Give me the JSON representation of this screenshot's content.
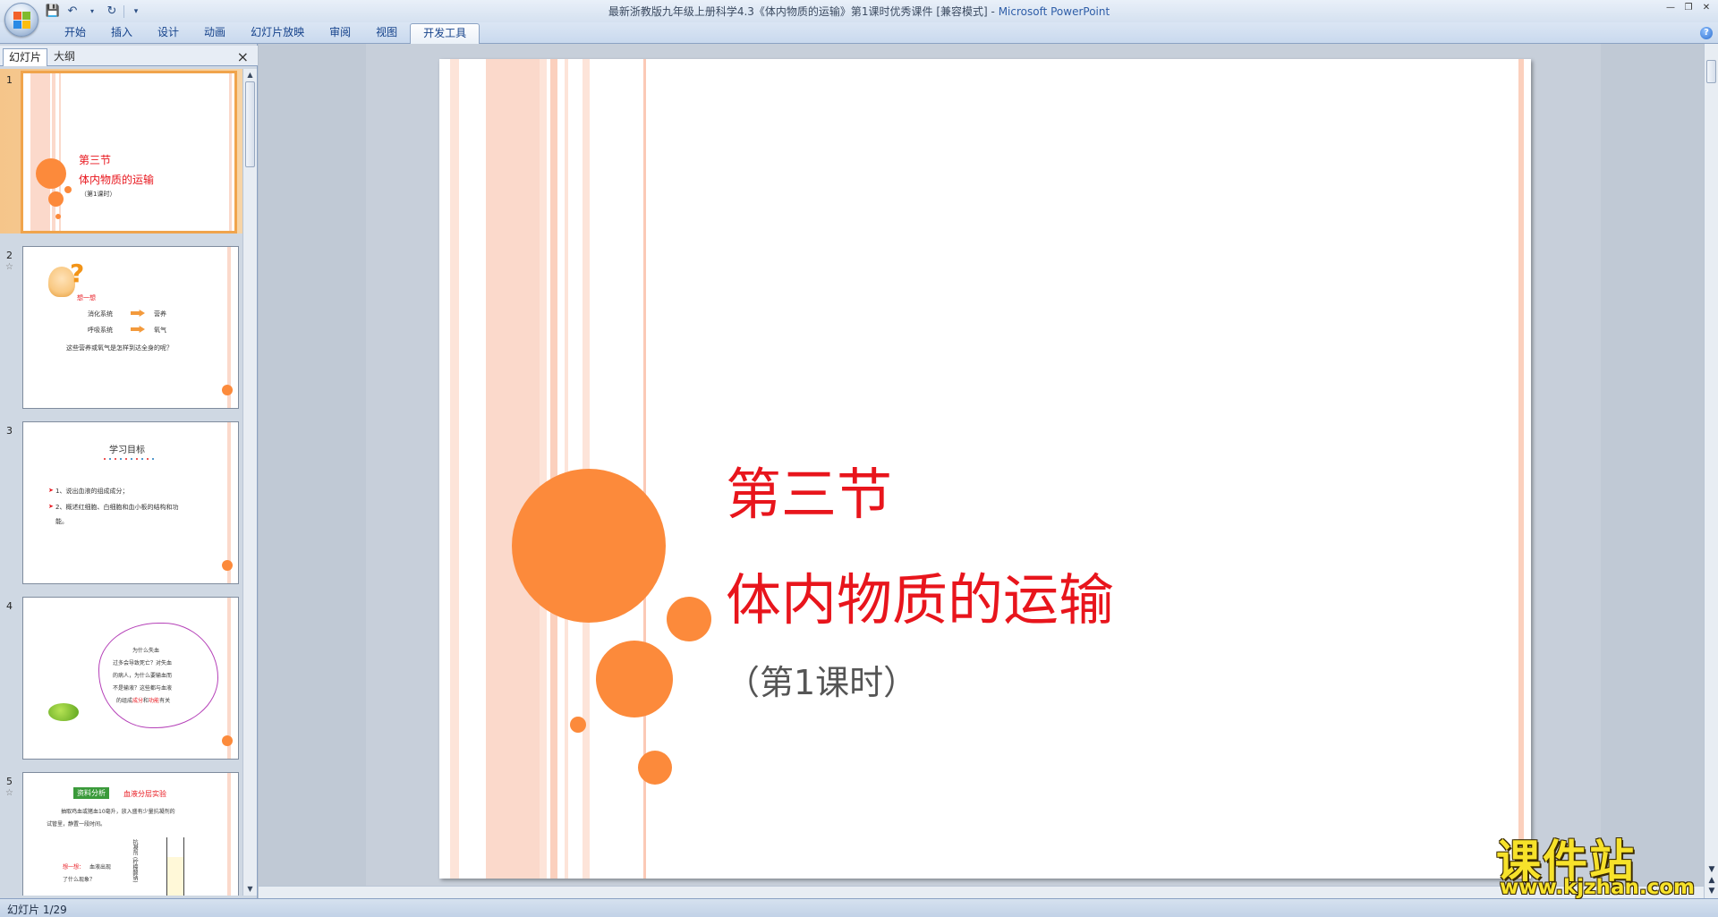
{
  "window": {
    "title_doc": "最新浙教版九年级上册科学4.3《体内物质的运输》第1课时优秀课件 [兼容模式]",
    "title_sep": " - ",
    "title_app": "Microsoft PowerPoint"
  },
  "ribbon": {
    "tabs": [
      "开始",
      "插入",
      "设计",
      "动画",
      "幻灯片放映",
      "审阅",
      "视图",
      "开发工具"
    ],
    "active_tab": "开发工具"
  },
  "left_pane": {
    "tab_slides": "幻灯片",
    "tab_outline": "大纲",
    "close": "×"
  },
  "thumbnails": {
    "s1": {
      "num": "1",
      "title": "第三节",
      "subtitle": "体内物质的运输",
      "note": "（第1课时）"
    },
    "s2": {
      "num": "2",
      "heading": "想一想",
      "row1_left": "消化系统",
      "row1_right": "营养",
      "row2_left": "呼吸系统",
      "row2_right": "氧气",
      "question": "这些营养或氧气是怎样到达全身的呢？"
    },
    "s3": {
      "num": "3",
      "heading": "学习目标",
      "item1": "1、说出血液的组成成分；",
      "item2": "2、概述红细胞、白细胞和血小板的结构和功",
      "item2b": "能。"
    },
    "s4": {
      "num": "4",
      "line1": "为什么失血",
      "line2": "过多会导致死亡？对失血",
      "line3": "的病人，为什么要输血而",
      "line4": "不是输液？这些都与血液",
      "line5_a": "的组成",
      "line5_b": "成分",
      "line5_c": "和",
      "line5_d": "功能",
      "line5_e": "有关"
    },
    "s5": {
      "num": "5",
      "badge": "资料分析",
      "heading": "血液分层实验",
      "line1": "抽取鸡血或猪血10毫升，放入盛有少量抗凝剂的",
      "line2": "试管里，静置一段时间。",
      "label_vert": "抗凝剂 (柠檬酸钠)",
      "q_prefix": "想一想：",
      "q_text": "血液出现",
      "q_text2": "了什么现象？"
    }
  },
  "slide": {
    "title": "第三节",
    "subtitle": "体内物质的运输",
    "note": "（第1课时）"
  },
  "status": {
    "slide_counter": "幻灯片 1/29"
  },
  "watermark": {
    "cn": "课件站",
    "url": "www.kjzhan.com"
  },
  "colors": {
    "accent_orange": "#fc8a3b",
    "title_red": "#e8151c",
    "stripe_pink": "#fbd9cb"
  }
}
